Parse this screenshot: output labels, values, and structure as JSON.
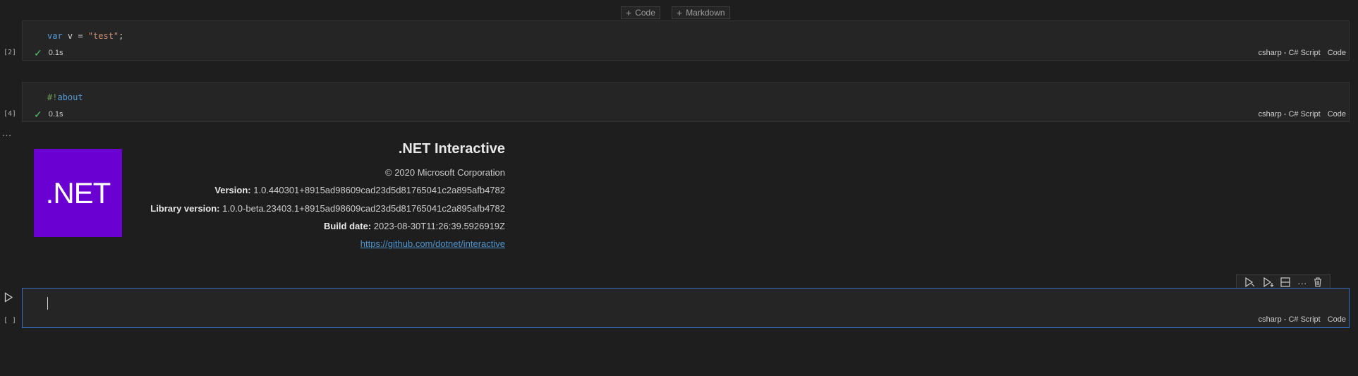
{
  "insert_toolbar": {
    "code_label": "Code",
    "markdown_label": "Markdown"
  },
  "cells": [
    {
      "exec_count": "[2]",
      "code": {
        "kw": "var",
        "rest_before_str": " v = ",
        "str": "\"test\"",
        "end": ";"
      },
      "duration": "0.1s",
      "language": "csharp - C# Script",
      "kind": "Code"
    },
    {
      "exec_count": "[4]",
      "code": {
        "prefix": "#!",
        "directive": "about"
      },
      "duration": "0.1s",
      "language": "csharp - C# Script",
      "kind": "Code"
    },
    {
      "exec_count": "[ ]",
      "code": "",
      "language": "csharp - C# Script",
      "kind": "Code"
    }
  ],
  "output": {
    "more_glyph": "...",
    "logo_text": ".NET",
    "title": ".NET Interactive",
    "copyright": "© 2020 Microsoft Corporation",
    "version_label": "Version:",
    "version_value": " 1.0.440301+8915ad98609cad23d5d81765041c2a895afb4782",
    "library_label": "Library version:",
    "library_value": " 1.0.0-beta.23403.1+8915ad98609cad23d5d81765041c2a895afb4782",
    "build_label": "Build date:",
    "build_value": " 2023-08-30T11:26:39.5926919Z",
    "link": "https://github.com/dotnet/interactive"
  },
  "icons": {
    "run_cell": "run-cell-icon",
    "execute_above": "execute-above-icon",
    "execute_below": "execute-below-icon",
    "split_cell": "split-cell-icon",
    "more": "more-actions-icon",
    "delete": "delete-cell-icon"
  }
}
